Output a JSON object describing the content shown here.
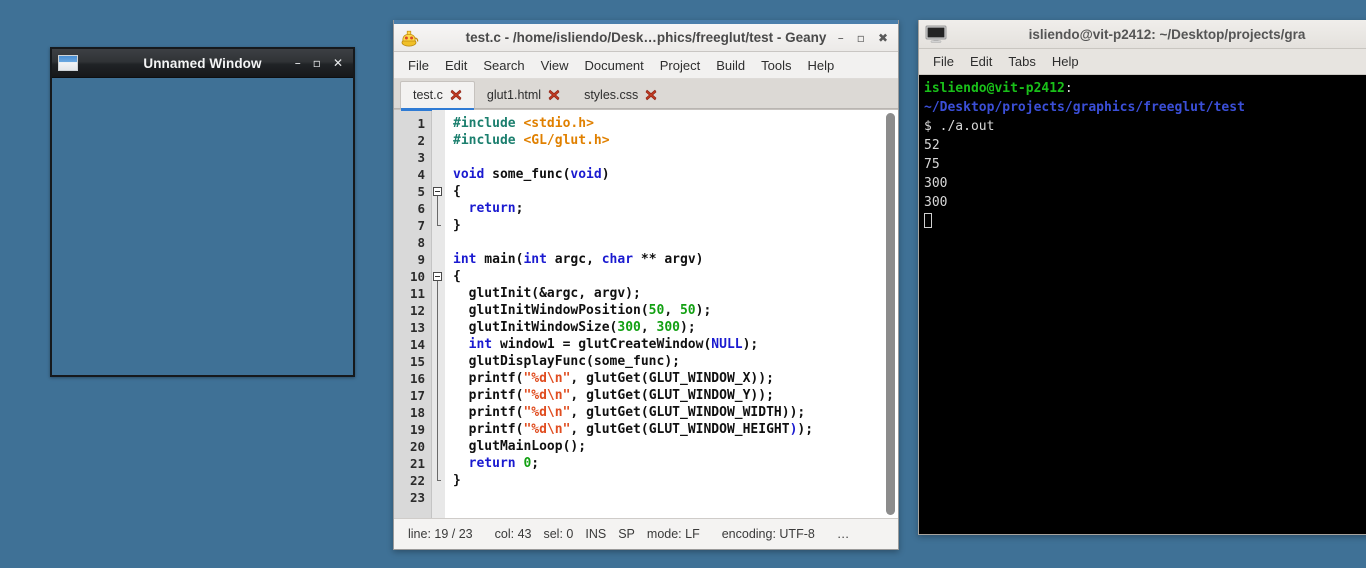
{
  "desktop": {
    "background_color": "#3f7196"
  },
  "glut_window": {
    "title": "Unnamed Window",
    "icon": "window-icon",
    "buttons": {
      "minimize": "–",
      "maximize": "▫",
      "close": "✕"
    },
    "canvas_color": "#3f7196"
  },
  "geany": {
    "title": "test.c - /home/isliendo/Desk…phics/freeglut/test - Geany",
    "icon": "geany-lamp-icon",
    "accent_color": "#4b7fab",
    "buttons": {
      "minimize": "–",
      "maximize": "▫",
      "close": "✖"
    },
    "menu": [
      "File",
      "Edit",
      "Search",
      "View",
      "Document",
      "Project",
      "Build",
      "Tools",
      "Help"
    ],
    "tabs": [
      {
        "label": "test.c",
        "active": true
      },
      {
        "label": "glut1.html",
        "active": false
      },
      {
        "label": "styles.css",
        "active": false
      }
    ],
    "editor": {
      "first_line": 1,
      "total_lines": 23,
      "lines": [
        {
          "n": 1,
          "tokens": [
            {
              "t": "#include ",
              "c": "t-pre"
            },
            {
              "t": "<stdio.h>",
              "c": "t-inc"
            }
          ]
        },
        {
          "n": 2,
          "tokens": [
            {
              "t": "#include ",
              "c": "t-pre"
            },
            {
              "t": "<GL/glut.h>",
              "c": "t-inc"
            }
          ]
        },
        {
          "n": 3,
          "tokens": []
        },
        {
          "n": 4,
          "tokens": [
            {
              "t": "void",
              "c": "t-kw"
            },
            {
              "t": " some_func(",
              "c": "t-plain"
            },
            {
              "t": "void",
              "c": "t-kw"
            },
            {
              "t": ")",
              "c": "t-plain"
            }
          ]
        },
        {
          "n": 5,
          "tokens": [
            {
              "t": "{",
              "c": "t-plain"
            }
          ],
          "fold": "start"
        },
        {
          "n": 6,
          "tokens": [
            {
              "t": "  ",
              "c": "t-plain"
            },
            {
              "t": "return",
              "c": "t-kw"
            },
            {
              "t": ";",
              "c": "t-plain"
            }
          ],
          "fold": "bar"
        },
        {
          "n": 7,
          "tokens": [
            {
              "t": "}",
              "c": "t-plain"
            }
          ],
          "fold": "end"
        },
        {
          "n": 8,
          "tokens": []
        },
        {
          "n": 9,
          "tokens": [
            {
              "t": "int",
              "c": "t-kw"
            },
            {
              "t": " main(",
              "c": "t-plain"
            },
            {
              "t": "int",
              "c": "t-kw"
            },
            {
              "t": " argc, ",
              "c": "t-plain"
            },
            {
              "t": "char",
              "c": "t-kw"
            },
            {
              "t": " ** argv)",
              "c": "t-plain"
            }
          ]
        },
        {
          "n": 10,
          "tokens": [
            {
              "t": "{",
              "c": "t-plain"
            }
          ],
          "fold": "start"
        },
        {
          "n": 11,
          "tokens": [
            {
              "t": "  glutInit(&argc, argv);",
              "c": "t-plain"
            }
          ],
          "fold": "bar"
        },
        {
          "n": 12,
          "tokens": [
            {
              "t": "  glutInitWindowPosition(",
              "c": "t-plain"
            },
            {
              "t": "50",
              "c": "t-num"
            },
            {
              "t": ", ",
              "c": "t-plain"
            },
            {
              "t": "50",
              "c": "t-num"
            },
            {
              "t": ");",
              "c": "t-plain"
            }
          ],
          "fold": "bar"
        },
        {
          "n": 13,
          "tokens": [
            {
              "t": "  glutInitWindowSize(",
              "c": "t-plain"
            },
            {
              "t": "300",
              "c": "t-num"
            },
            {
              "t": ", ",
              "c": "t-plain"
            },
            {
              "t": "300",
              "c": "t-num"
            },
            {
              "t": ");",
              "c": "t-plain"
            }
          ],
          "fold": "bar"
        },
        {
          "n": 14,
          "tokens": [
            {
              "t": "  ",
              "c": "t-plain"
            },
            {
              "t": "int",
              "c": "t-kw"
            },
            {
              "t": " window1 = glutCreateWindow(",
              "c": "t-plain"
            },
            {
              "t": "NULL",
              "c": "t-kw"
            },
            {
              "t": ");",
              "c": "t-plain"
            }
          ],
          "fold": "bar"
        },
        {
          "n": 15,
          "tokens": [
            {
              "t": "  glutDisplayFunc(some_func);",
              "c": "t-plain"
            }
          ],
          "fold": "bar"
        },
        {
          "n": 16,
          "tokens": [
            {
              "t": "  printf(",
              "c": "t-plain"
            },
            {
              "t": "\"%d\\n\"",
              "c": "t-str"
            },
            {
              "t": ", glutGet(GLUT_WINDOW_X));",
              "c": "t-plain"
            }
          ],
          "fold": "bar"
        },
        {
          "n": 17,
          "tokens": [
            {
              "t": "  printf(",
              "c": "t-plain"
            },
            {
              "t": "\"%d\\n\"",
              "c": "t-str"
            },
            {
              "t": ", glutGet(GLUT_WINDOW_Y));",
              "c": "t-plain"
            }
          ],
          "fold": "bar"
        },
        {
          "n": 18,
          "tokens": [
            {
              "t": "  printf(",
              "c": "t-plain"
            },
            {
              "t": "\"%d\\n\"",
              "c": "t-str"
            },
            {
              "t": ", glutGet(GLUT_WINDOW_WIDTH));",
              "c": "t-plain"
            }
          ],
          "fold": "bar"
        },
        {
          "n": 19,
          "tokens": [
            {
              "t": "  printf(",
              "c": "t-plain"
            },
            {
              "t": "\"%d\\n\"",
              "c": "t-str"
            },
            {
              "t": ", glutGet(GLUT_WINDOW_HEIGHT",
              "c": "t-plain"
            },
            {
              "t": ")",
              "c": "t-kw"
            },
            {
              "t": ");",
              "c": "t-plain"
            }
          ],
          "fold": "bar"
        },
        {
          "n": 20,
          "tokens": [
            {
              "t": "  glutMainLoop();",
              "c": "t-plain"
            }
          ],
          "fold": "bar"
        },
        {
          "n": 21,
          "tokens": [
            {
              "t": "  ",
              "c": "t-plain"
            },
            {
              "t": "return",
              "c": "t-kw"
            },
            {
              "t": " ",
              "c": "t-plain"
            },
            {
              "t": "0",
              "c": "t-num"
            },
            {
              "t": ";",
              "c": "t-plain"
            }
          ],
          "fold": "bar"
        },
        {
          "n": 22,
          "tokens": [
            {
              "t": "}",
              "c": "t-plain"
            }
          ],
          "fold": "end"
        },
        {
          "n": 23,
          "tokens": []
        }
      ]
    },
    "statusbar": {
      "line": "line: 19 / 23",
      "col": "col: 43",
      "sel": "sel: 0",
      "insert_mode": "INS",
      "indent": "SP",
      "eol_mode": "mode: LF",
      "encoding": "encoding: UTF-8",
      "overflow": "…"
    }
  },
  "terminal": {
    "title": "isliendo@vit-p2412: ~/Desktop/projects/gra",
    "icon": "monitor-icon",
    "menu": [
      "File",
      "Edit",
      "Tabs",
      "Help"
    ],
    "lines": [
      {
        "segments": [
          {
            "t": "isliendo@vit-p2412",
            "c": "c-green"
          },
          {
            "t": ":",
            "c": "c-white"
          }
        ]
      },
      {
        "segments": [
          {
            "t": "~/Desktop/projects/graphics/freeglut/test",
            "c": "c-blue"
          }
        ]
      },
      {
        "segments": [
          {
            "t": "$ ./a.out",
            "c": "c-white"
          }
        ]
      },
      {
        "segments": [
          {
            "t": "52",
            "c": "c-white"
          }
        ]
      },
      {
        "segments": [
          {
            "t": "75",
            "c": "c-white"
          }
        ]
      },
      {
        "segments": [
          {
            "t": "300",
            "c": "c-white"
          }
        ]
      },
      {
        "segments": [
          {
            "t": "300",
            "c": "c-white"
          }
        ]
      }
    ],
    "cursor": "block-outline"
  }
}
